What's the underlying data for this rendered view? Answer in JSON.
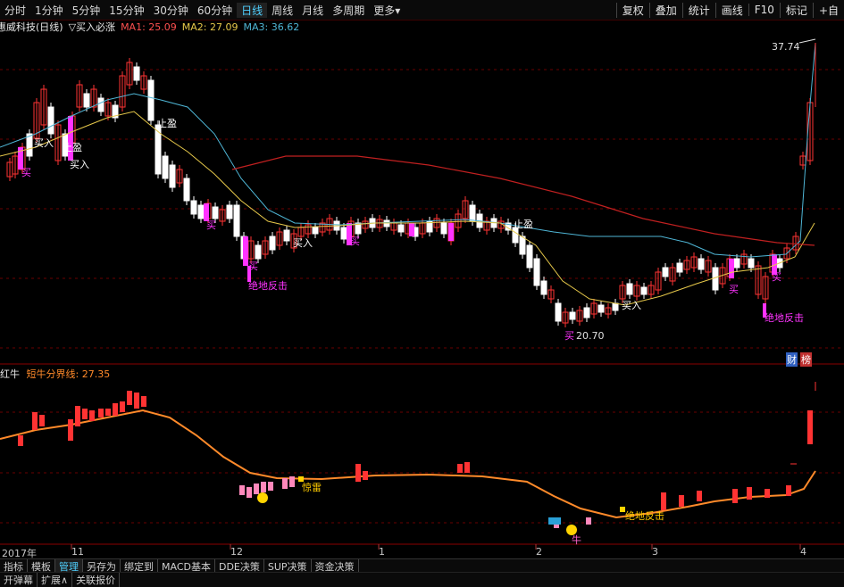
{
  "toolbar": {
    "timeframes": [
      "分时",
      "1分钟",
      "5分钟",
      "15分钟",
      "30分钟",
      "60分钟",
      "日线",
      "周线",
      "月线",
      "多周期",
      "更多"
    ],
    "active_timeframe": "日线",
    "right_buttons": [
      "复权",
      "叠加",
      "统计",
      "画线",
      "F10",
      "标记",
      "+自"
    ]
  },
  "legend": {
    "stock": "惠威科技(日线)",
    "indicator": "▽买入必涨",
    "ma1": "MA1: 25.09",
    "ma2": "MA2: 27.09",
    "ma3": "MA3: 36.62"
  },
  "annotations": {
    "high_price": "37.74",
    "low_price": "20.70",
    "buy": "买入",
    "buy_short": "买",
    "take_profit": "止盈",
    "rebound": "绝地反击",
    "icon_cai": "财",
    "icon_bang": "榜"
  },
  "sub_legend": {
    "name": "红牛",
    "line": "短牛分界线: 27.35"
  },
  "sub_annotations": {
    "bull": "牛",
    "thunder": "惊雷",
    "rebound": "绝地反击"
  },
  "x_axis": [
    "2017年",
    "11",
    "12",
    "1",
    "2",
    "3",
    "4"
  ],
  "bottom_tabs": [
    "指标",
    "模板",
    "管理",
    "另存为",
    "绑定到",
    "MACD基本",
    "DDE决策",
    "SUP决策",
    "资金决策"
  ],
  "bottom_tabs_active": "管理",
  "bottom_row2": [
    "开弹幕",
    "扩展∧",
    "关联报价"
  ],
  "colors": {
    "up": "#ff3333",
    "down": "#ffffff",
    "ma1": "#ffffff",
    "ma2": "#e6c84a",
    "ma3": "#4fb6d6",
    "ma_long": "#c02020",
    "signal": "#ff33ff",
    "bull_line": "#ff8a2a"
  }
}
